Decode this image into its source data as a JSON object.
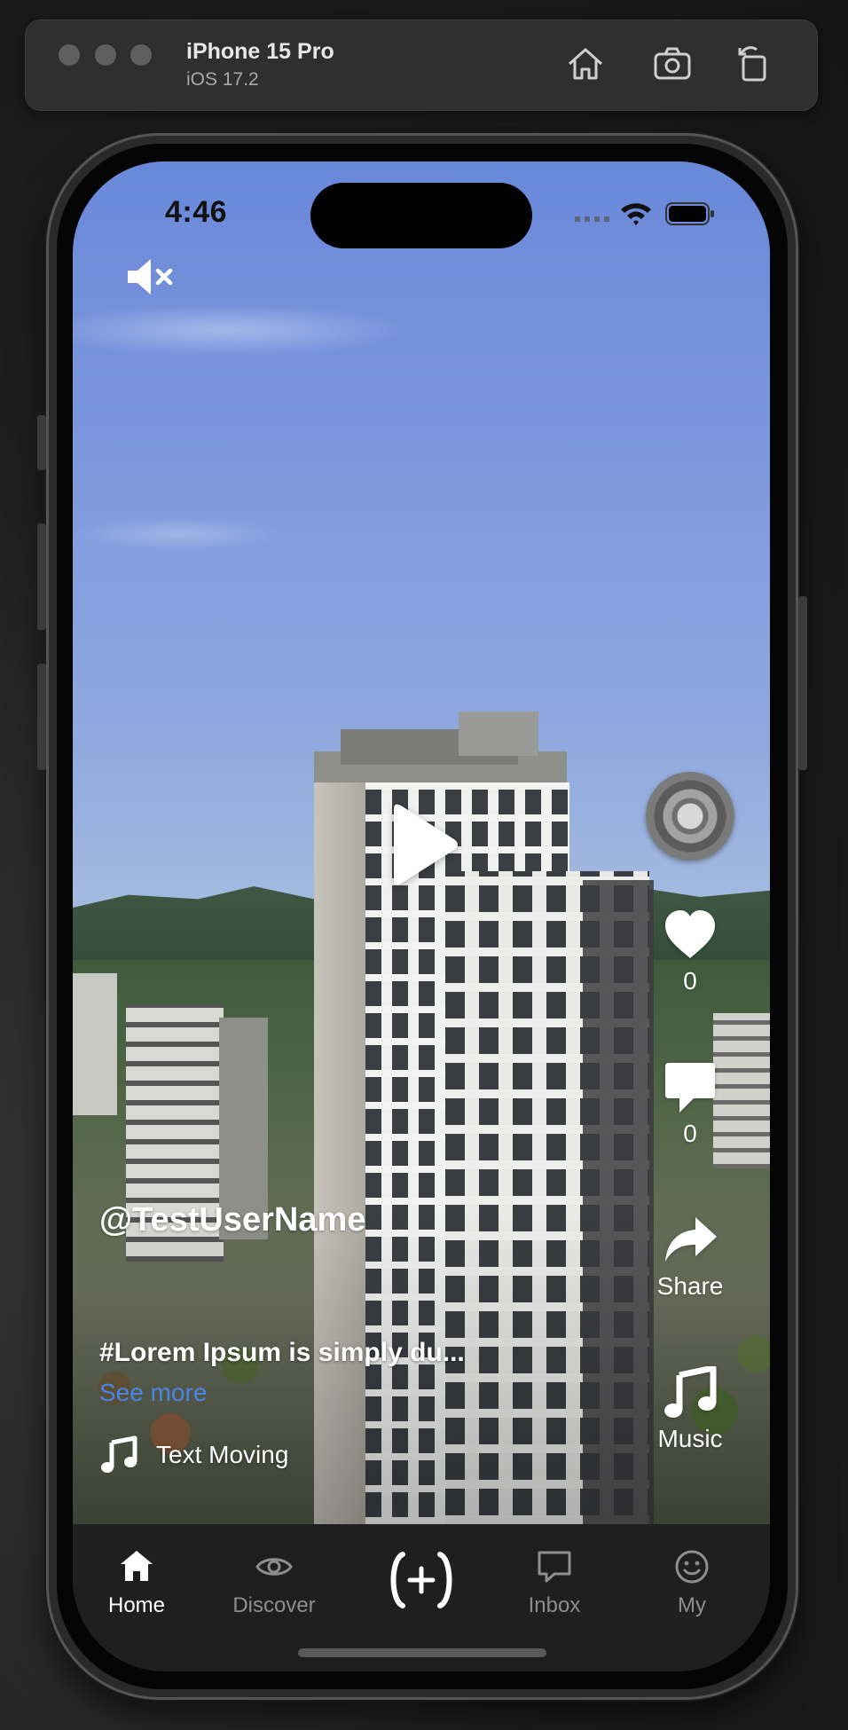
{
  "simulator": {
    "device_name": "iPhone 15 Pro",
    "os_version": "iOS 17.2",
    "toolbar": [
      "home-icon",
      "screenshot-icon",
      "rotate-icon"
    ]
  },
  "status_bar": {
    "time": "4:46",
    "icons": [
      "cellular-icon",
      "wifi-icon",
      "battery-icon"
    ]
  },
  "video": {
    "muted": true,
    "playing": false,
    "author": "@TestUserName",
    "caption": "#Lorem Ipsum is simply du...",
    "see_more_label": "See more",
    "sound_name": "Text Moving"
  },
  "actions": {
    "like_count": "0",
    "comment_count": "0",
    "share_label": "Share",
    "music_label": "Music"
  },
  "tabbar": {
    "items": [
      {
        "label": "Home",
        "icon": "home-icon",
        "active": true
      },
      {
        "label": "Discover",
        "icon": "eye-icon",
        "active": false
      },
      {
        "label": "",
        "icon": "create-icon",
        "active": false
      },
      {
        "label": "Inbox",
        "icon": "inbox-icon",
        "active": false
      },
      {
        "label": "My",
        "icon": "smiley-icon",
        "active": false
      }
    ]
  },
  "colors": {
    "accent_link": "#4a86e8",
    "tabbar_bg": "#1f1f1f",
    "tab_inactive": "#8e8e8e",
    "tab_active": "#ffffff"
  }
}
